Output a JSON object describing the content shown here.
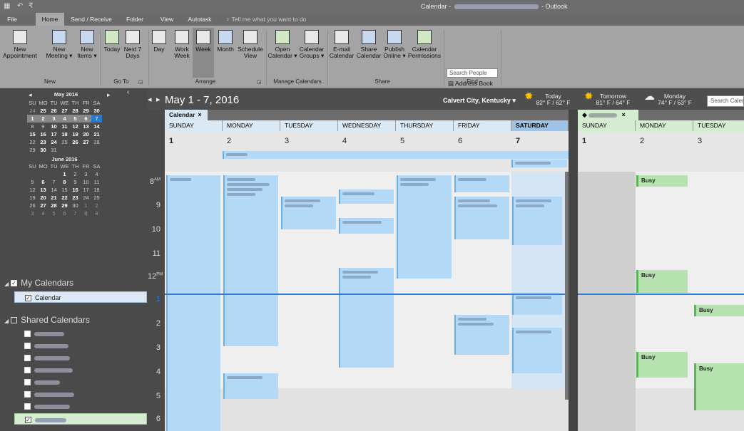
{
  "window": {
    "title_prefix": "Calendar - ",
    "title_suffix": " - Outlook"
  },
  "menu": {
    "tabs": [
      "File",
      "Home",
      "Send / Receive",
      "Folder",
      "View",
      "Autotask"
    ],
    "tell_me": "Tell me what you want to do"
  },
  "ribbon": {
    "buttons": [
      {
        "label": "New\nAppointment"
      },
      {
        "label": "New\nMeeting ▾"
      },
      {
        "label": "New\nItems ▾"
      },
      {
        "label": "Today"
      },
      {
        "label": "Next 7\nDays"
      },
      {
        "label": "Day"
      },
      {
        "label": "Work\nWeek"
      },
      {
        "label": "Week"
      },
      {
        "label": "Month"
      },
      {
        "label": "Schedule\nView"
      },
      {
        "label": "Open\nCalendar ▾"
      },
      {
        "label": "Calendar\nGroups ▾"
      },
      {
        "label": "E-mail\nCalendar"
      },
      {
        "label": "Share\nCalendar"
      },
      {
        "label": "Publish\nOnline ▾"
      },
      {
        "label": "Calendar\nPermissions"
      }
    ],
    "groups": [
      "New",
      "Go To",
      "Arrange",
      "Manage Calendars",
      "Share",
      "Find"
    ],
    "search_people": "Search People",
    "address_book": "Address Book"
  },
  "nav": {
    "may": {
      "title": "May 2016",
      "days": [
        "SU",
        "MO",
        "TU",
        "WE",
        "TH",
        "FR",
        "SA"
      ],
      "weeks": [
        [
          "24",
          "25",
          "26",
          "27",
          "28",
          "29",
          "30"
        ],
        [
          "1",
          "2",
          "3",
          "4",
          "5",
          "6",
          "7"
        ],
        [
          "8",
          "9",
          "10",
          "11",
          "12",
          "13",
          "14"
        ],
        [
          "15",
          "16",
          "17",
          "18",
          "19",
          "20",
          "21"
        ],
        [
          "22",
          "23",
          "24",
          "25",
          "26",
          "27",
          "28"
        ],
        [
          "29",
          "30",
          "31",
          "",
          "",
          "",
          ""
        ]
      ]
    },
    "june": {
      "title": "June 2016",
      "days": [
        "SU",
        "MO",
        "TU",
        "WE",
        "TH",
        "FR",
        "SA"
      ],
      "weeks": [
        [
          "",
          "",
          "",
          "1",
          "2",
          "3",
          "4"
        ],
        [
          "5",
          "6",
          "7",
          "8",
          "9",
          "10",
          "11"
        ],
        [
          "12",
          "13",
          "14",
          "15",
          "16",
          "17",
          "18"
        ],
        [
          "19",
          "20",
          "21",
          "22",
          "23",
          "24",
          "25"
        ],
        [
          "26",
          "27",
          "28",
          "29",
          "30",
          "1",
          "2"
        ],
        [
          "3",
          "4",
          "5",
          "6",
          "7",
          "8",
          "9"
        ]
      ]
    },
    "my_calendars": "My Calendars",
    "calendar": "Calendar",
    "shared_calendars": "Shared Calendars"
  },
  "calendar": {
    "range": "May 1 - 7, 2016",
    "location": "Calvert City, Kentucky",
    "weather": [
      {
        "day": "Today",
        "temp": "82° F / 62° F"
      },
      {
        "day": "Tomorrow",
        "temp": "81° F / 64° F"
      },
      {
        "day": "Monday",
        "temp": "74° F / 63° F"
      }
    ],
    "search_placeholder": "Search Calendar",
    "tab1": "Calendar",
    "tab_close": "×",
    "days1": [
      {
        "name": "SUNDAY",
        "num": "1"
      },
      {
        "name": "MONDAY",
        "num": "2"
      },
      {
        "name": "TUESDAY",
        "num": "3"
      },
      {
        "name": "WEDNESDAY",
        "num": "4"
      },
      {
        "name": "THURSDAY",
        "num": "5"
      },
      {
        "name": "FRIDAY",
        "num": "6"
      },
      {
        "name": "SATURDAY",
        "num": "7"
      }
    ],
    "days2": [
      {
        "name": "SUNDAY",
        "num": "1"
      },
      {
        "name": "MONDAY",
        "num": "2"
      },
      {
        "name": "TUESDAY",
        "num": "3"
      }
    ],
    "hours": [
      "8",
      "9",
      "10",
      "11",
      "12",
      "1",
      "2",
      "3",
      "4",
      "5",
      "6"
    ],
    "am": "AM",
    "pm": "PM",
    "busy": "Busy"
  },
  "colors": {
    "accent": "#2a7acb",
    "event_blue": "#b3d9f7",
    "busy_green": "#b6e2b0"
  }
}
